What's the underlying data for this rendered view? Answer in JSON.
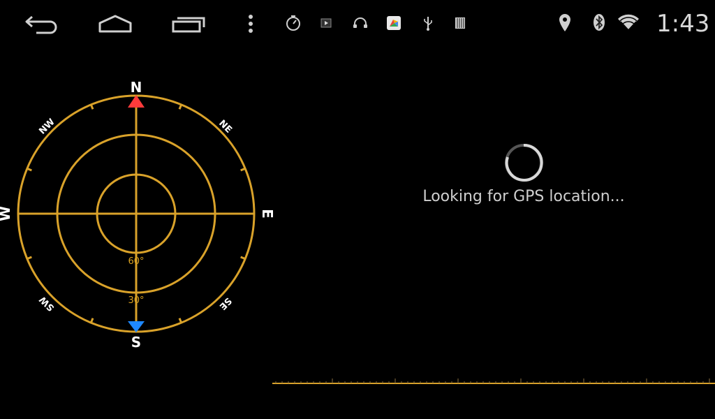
{
  "status_bar": {
    "nav_icons": [
      "back-arrow-icon",
      "home-icon",
      "recent-apps-icon",
      "overflow-menu-icon"
    ],
    "notification_icons": [
      "stopwatch-icon",
      "play-icon",
      "headphones-icon",
      "colorful-app-icon",
      "usb-icon",
      "sd-card-icon"
    ],
    "system_icons": [
      "location-pin-icon",
      "bluetooth-icon",
      "wifi-icon"
    ],
    "clock": "1:43"
  },
  "compass": {
    "cardinals": {
      "n": "N",
      "s": "S",
      "e": "E",
      "w": "W"
    },
    "intercardinals": {
      "ne": "NE",
      "nw": "NW",
      "se": "SE",
      "sw": "SW"
    },
    "elevation_labels": {
      "inner": "60°",
      "middle": "30°"
    },
    "colors": {
      "ring": "#d9a22a",
      "north_marker": "#ff3b3b",
      "south_marker": "#1e88ff"
    }
  },
  "gps": {
    "status_text": "Looking for GPS location..."
  },
  "colors": {
    "background": "#000000",
    "accent": "#d9a22a"
  }
}
